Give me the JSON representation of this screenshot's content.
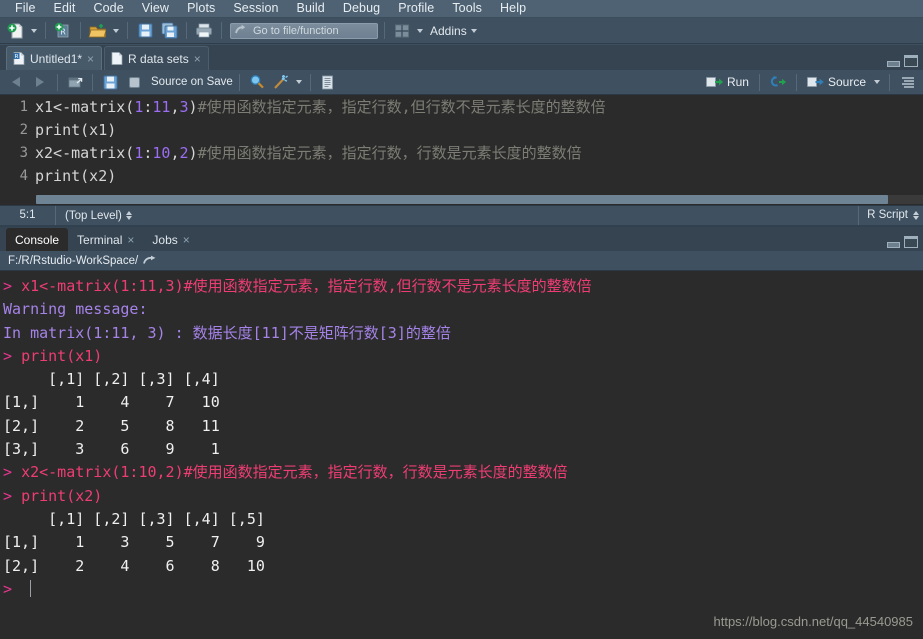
{
  "menubar": {
    "items": [
      {
        "label": "File"
      },
      {
        "label": "Edit"
      },
      {
        "label": "Code"
      },
      {
        "label": "View"
      },
      {
        "label": "Plots"
      },
      {
        "label": "Session"
      },
      {
        "label": "Build"
      },
      {
        "label": "Debug"
      },
      {
        "label": "Profile"
      },
      {
        "label": "Tools"
      },
      {
        "label": "Help"
      }
    ]
  },
  "toolbar": {
    "new_file_icon": "new-file-icon",
    "new_project_icon": "new-project-icon",
    "open_file_icon": "open-folder-icon",
    "save_icon": "save-icon",
    "save_all_icon": "save-all-icon",
    "print_icon": "print-icon",
    "goto_search_icon": "goto-arrow-icon",
    "goto_placeholder": "Go to file/function",
    "workspace_panes_icon": "workspace-panes-icon",
    "addins_label": "Addins"
  },
  "source_pane": {
    "tabs": [
      {
        "label": "Untitled1*",
        "icon": "r-script-icon",
        "close": "×",
        "active": true
      },
      {
        "label": "R data sets",
        "icon": "document-icon",
        "close": "×",
        "active": false
      }
    ],
    "window_controls": {
      "minimize": "minimize-icon",
      "maximize": "maximize-icon"
    },
    "editor_toolbar": {
      "back_icon": "back-arrow-icon",
      "forward_icon": "forward-arrow-icon",
      "show_doc_outline_icon": "popout-window-icon",
      "save_icon": "save-icon",
      "source_on_save_label": "Source on Save",
      "find_icon": "magnifier-icon",
      "code_tools_icon": "magic-wand-icon",
      "compile_report_icon": "notebook-icon",
      "run_label": "Run",
      "rerun_icon": "rerun-icon",
      "source_label": "Source",
      "outline_icon": "outline-icon"
    },
    "code": {
      "lines": [
        {
          "number": "1",
          "segments": [
            {
              "text": "x1<-matrix(",
              "cls": "tok-pun"
            },
            {
              "text": "1",
              "cls": "tok-num"
            },
            {
              "text": ":",
              "cls": "tok-pun"
            },
            {
              "text": "11",
              "cls": "tok-num"
            },
            {
              "text": ",",
              "cls": "tok-pun"
            },
            {
              "text": "3",
              "cls": "tok-num"
            },
            {
              "text": ")",
              "cls": "tok-pun"
            },
            {
              "text": "#使用函数指定元素，指定行数,但行数不是元素长度的整数倍",
              "cls": "tok-cmt"
            }
          ]
        },
        {
          "number": "2",
          "segments": [
            {
              "text": "print(x1)",
              "cls": "tok-pun"
            }
          ]
        },
        {
          "number": "3",
          "segments": [
            {
              "text": "x2<-matrix(",
              "cls": "tok-pun"
            },
            {
              "text": "1",
              "cls": "tok-num"
            },
            {
              "text": ":",
              "cls": "tok-pun"
            },
            {
              "text": "10",
              "cls": "tok-num"
            },
            {
              "text": ",",
              "cls": "tok-pun"
            },
            {
              "text": "2",
              "cls": "tok-num"
            },
            {
              "text": ")",
              "cls": "tok-pun"
            },
            {
              "text": "#使用函数指定元素，指定行数，行数是元素长度的整数倍",
              "cls": "tok-cmt"
            }
          ]
        },
        {
          "number": "4",
          "segments": [
            {
              "text": "print(x2)",
              "cls": "tok-pun"
            }
          ]
        }
      ]
    },
    "status": {
      "cursor_position": "5:1",
      "scope": "(Top Level)",
      "file_type": "R Script"
    }
  },
  "console_pane": {
    "tabs": [
      {
        "label": "Console",
        "close": "",
        "active": true
      },
      {
        "label": "Terminal",
        "close": "×",
        "active": false
      },
      {
        "label": "Jobs",
        "close": "×",
        "active": false
      }
    ],
    "window_controls": {
      "minimize": "minimize-icon",
      "maximize": "maximize-icon"
    },
    "working_directory": "F:/R/Rstudio-WorkSpace/",
    "working_directory_icon": "goto-directory-icon",
    "output_lines": [
      {
        "type": "input",
        "prompt": "> ",
        "text": "x1<-matrix(1:11,3)#使用函数指定元素，指定行数,但行数不是元素长度的整数倍"
      },
      {
        "type": "warning_header",
        "prompt": "",
        "text": "Warning message:"
      },
      {
        "type": "warning",
        "prompt": "",
        "text": "In matrix(1:11, 3) : 数据长度[11]不是矩阵行数[3]的整倍"
      },
      {
        "type": "input",
        "prompt": "> ",
        "text": "print(x1)"
      },
      {
        "type": "output",
        "prompt": "",
        "text": "     [,1] [,2] [,3] [,4]"
      },
      {
        "type": "output",
        "prompt": "",
        "text": "[1,]    1    4    7   10"
      },
      {
        "type": "output",
        "prompt": "",
        "text": "[2,]    2    5    8   11"
      },
      {
        "type": "output",
        "prompt": "",
        "text": "[3,]    3    6    9    1"
      },
      {
        "type": "input",
        "prompt": "> ",
        "text": "x2<-matrix(1:10,2)#使用函数指定元素，指定行数，行数是元素长度的整数倍"
      },
      {
        "type": "input",
        "prompt": "> ",
        "text": "print(x2)"
      },
      {
        "type": "output",
        "prompt": "",
        "text": "     [,1] [,2] [,3] [,4] [,5]"
      },
      {
        "type": "output",
        "prompt": "",
        "text": "[1,]    1    3    5    7    9"
      },
      {
        "type": "output",
        "prompt": "",
        "text": "[2,]    2    4    6    8   10"
      },
      {
        "type": "prompt_only",
        "prompt": "> ",
        "text": ""
      }
    ]
  },
  "watermark": {
    "text": "https://blog.csdn.net/qq_44540985"
  },
  "colors": {
    "menubar_bg": "#4e6273",
    "toolbar_bg": "#3f5060",
    "editor_bg": "#2b2b2b",
    "console_input": "#ef3d74",
    "console_warning": "#a583e8",
    "console_output": "#f0f0f0",
    "code_number": "#9b6ef3",
    "code_comment": "#7d7d75"
  }
}
